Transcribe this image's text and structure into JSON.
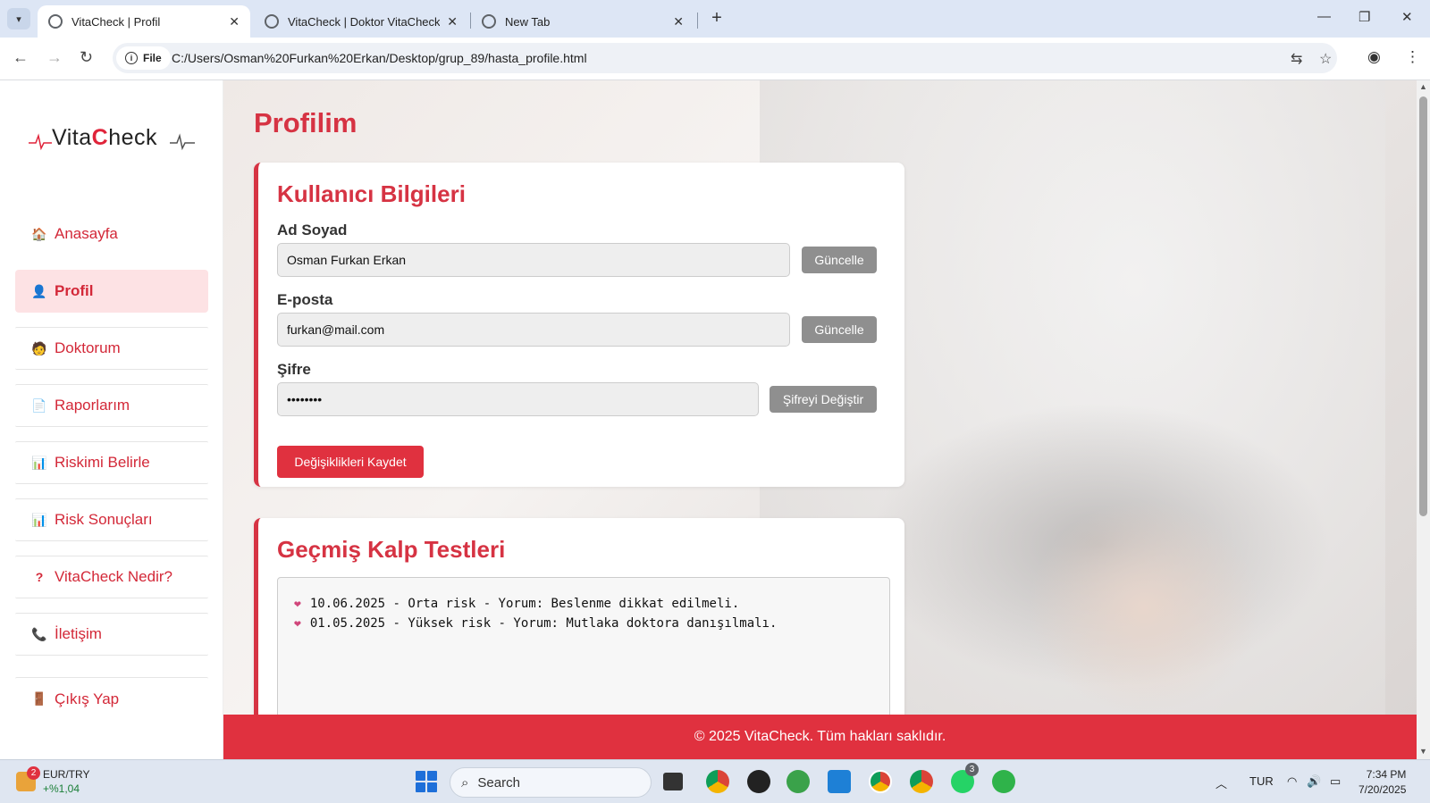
{
  "browser": {
    "tabs": [
      {
        "title": "VitaCheck | Profil",
        "active": true
      },
      {
        "title": "VitaCheck | Doktor VitaCheck N",
        "active": false
      },
      {
        "title": "New Tab",
        "active": false
      }
    ],
    "file_chip": "File",
    "url": "C:/Users/Osman%20Furkan%20Erkan/Desktop/grup_89/hasta_profile.html"
  },
  "sidebar": {
    "logo": {
      "part1": "Vita",
      "part2": "C",
      "part3": "heck"
    },
    "items": [
      {
        "label": "Anasayfa",
        "icon": "house-icon"
      },
      {
        "label": "Profil",
        "icon": "user-icon"
      },
      {
        "label": "Doktorum",
        "icon": "doctor-icon"
      },
      {
        "label": "Raporlarım",
        "icon": "document-icon"
      },
      {
        "label": "Riskimi Belirle",
        "icon": "bar-chart-icon"
      },
      {
        "label": "Risk Sonuçları",
        "icon": "bar-chart-icon"
      },
      {
        "label": "VitaCheck Nedir?",
        "icon": "question-icon"
      },
      {
        "label": "İletişim",
        "icon": "phone-icon"
      },
      {
        "label": "Çıkış Yap",
        "icon": "door-icon"
      }
    ]
  },
  "main": {
    "page_title": "Profilim",
    "user_card": {
      "title": "Kullanıcı Bilgileri",
      "name_label": "Ad Soyad",
      "name_value": "Osman Furkan Erkan",
      "name_button": "Güncelle",
      "email_label": "E-posta",
      "email_value": "furkan@mail.com",
      "email_button": "Güncelle",
      "password_label": "Şifre",
      "password_value": "••••••••",
      "password_button": "Şifreyi Değiştir",
      "save_button": "Değişiklikleri Kaydet"
    },
    "history_card": {
      "title": "Geçmiş Kalp Testleri",
      "entries": [
        "10.06.2025 - Orta risk - Yorum: Beslenme dikkat edilmeli.",
        "01.05.2025 - Yüksek risk - Yorum: Mutlaka doktora danışılmalı."
      ]
    },
    "footer": "© 2025 VitaCheck. Tüm hakları saklıdır."
  },
  "colors": {
    "accent": "#d63343",
    "footer": "#e0313f",
    "active_nav_bg": "#fde2e4"
  },
  "taskbar": {
    "widget_badge": "2",
    "widget_title": "EUR/TRY",
    "widget_value": "+%1,04",
    "search_placeholder": "Search",
    "whatsapp_badge": "3",
    "language": "TUR",
    "time": "7:34 PM",
    "date": "7/20/2025"
  }
}
